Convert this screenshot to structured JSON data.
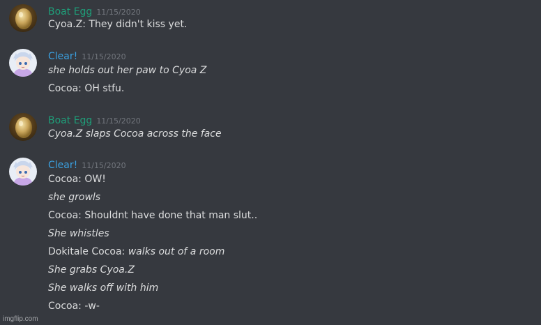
{
  "colors": {
    "background": "#36393f",
    "message_text": "#dcddde",
    "timestamp": "#72767d",
    "boat_egg_name": "#1f9e79",
    "clear_name": "#3aa0e0"
  },
  "messages": [
    {
      "author": "Boat Egg",
      "author_color": "#1f9e79",
      "avatar_icon": "egg-avatar-icon",
      "timestamp": "11/15/2020",
      "lines": [
        {
          "text": "Cyoa.Z: They didn't kiss yet.",
          "style": "normal"
        }
      ]
    },
    {
      "author": "Clear!",
      "author_color": "#3aa0e0",
      "avatar_icon": "anime-character-avatar-icon",
      "timestamp": "11/15/2020",
      "lines": [
        {
          "text": "she holds out her paw to Cyoa Z",
          "style": "italic"
        },
        {
          "text": "Cocoa: OH stfu.",
          "style": "normal"
        }
      ]
    },
    {
      "author": "Boat Egg",
      "author_color": "#1f9e79",
      "avatar_icon": "egg-avatar-icon",
      "timestamp": "11/15/2020",
      "lines": [
        {
          "text": "Cyoa.Z slaps Cocoa across the face",
          "style": "italic"
        }
      ]
    },
    {
      "author": "Clear!",
      "author_color": "#3aa0e0",
      "avatar_icon": "anime-character-avatar-icon",
      "timestamp": "11/15/2020",
      "lines": [
        {
          "text": "Cocoa: OW!",
          "style": "normal"
        },
        {
          "text": "she growls",
          "style": "italic"
        },
        {
          "text": "Cocoa: Shouldnt have done that man slut..",
          "style": "normal"
        },
        {
          "text": "She whistles",
          "style": "italic"
        },
        {
          "prefix": "Dokitale Cocoa: ",
          "text": "walks out of a room",
          "style": "mixed"
        },
        {
          "text": "She grabs Cyoa.Z",
          "style": "italic"
        },
        {
          "text": "She walks off with him",
          "style": "italic"
        },
        {
          "text": "Cocoa: -w-",
          "style": "normal"
        }
      ]
    }
  ],
  "watermark": "imgflip.com"
}
